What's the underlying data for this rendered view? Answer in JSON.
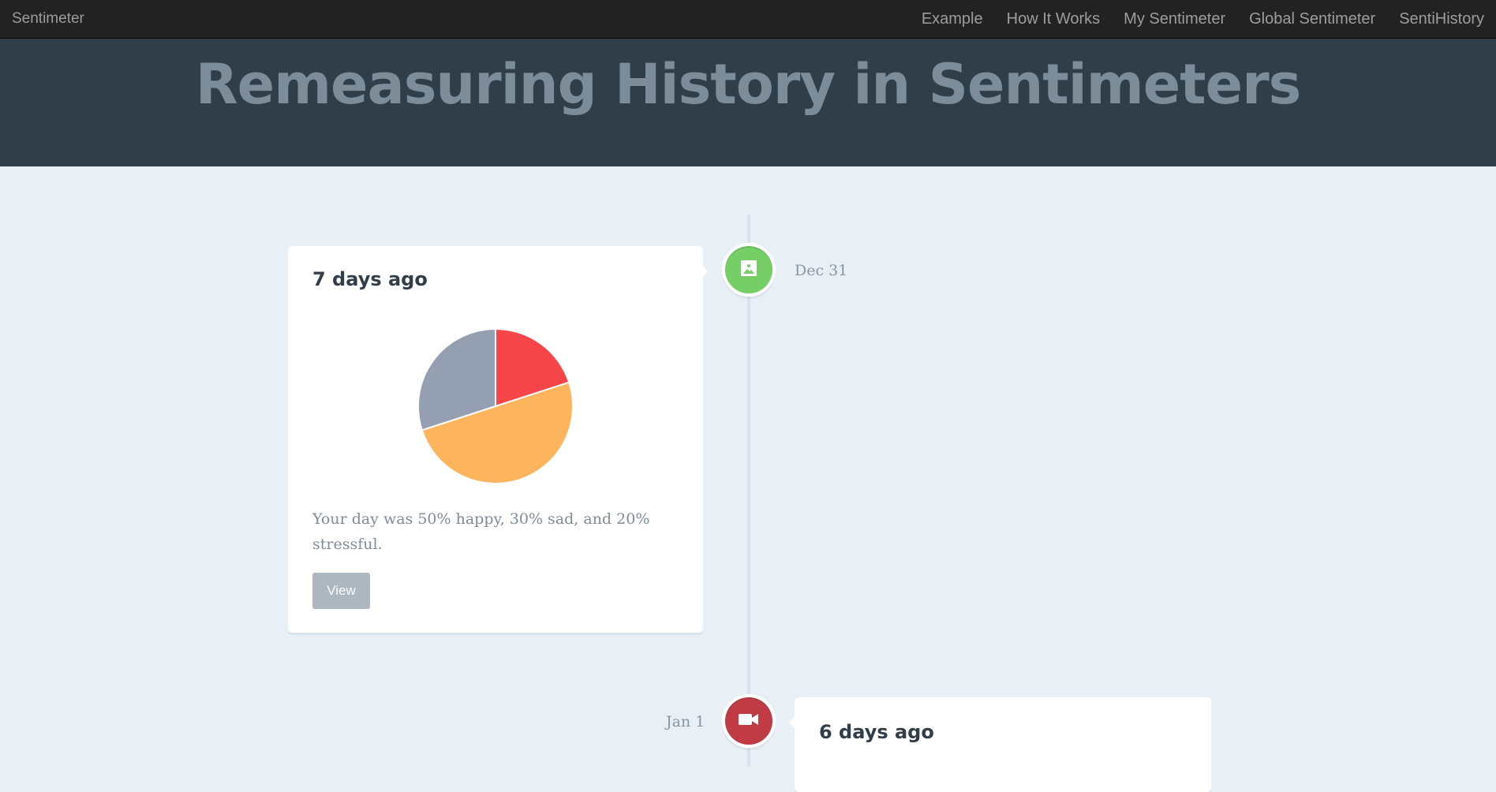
{
  "navbar": {
    "brand": "Sentimeter",
    "links": [
      "Example",
      "How It Works",
      "My Sentimeter",
      "Global Sentimeter",
      "SentiHistory"
    ]
  },
  "header": {
    "title": "Remeasuring History in Sentimeters"
  },
  "timeline": [
    {
      "date": "Dec 31",
      "icon": "picture-icon",
      "marker_color": "#75ce66",
      "title": "7 days ago",
      "text": "Your day was 50% happy, 30% sad, and 20% stressful.",
      "button_label": "View"
    },
    {
      "date": "Jan 1",
      "icon": "video-icon",
      "marker_color": "#c03b44",
      "title": "6 days ago"
    }
  ],
  "chart_data": {
    "type": "pie",
    "categories": [
      "happy",
      "sad",
      "stressful"
    ],
    "values": [
      50,
      30,
      20
    ],
    "colors": [
      "#fdb45c",
      "#949fb1",
      "#f7464a"
    ]
  }
}
